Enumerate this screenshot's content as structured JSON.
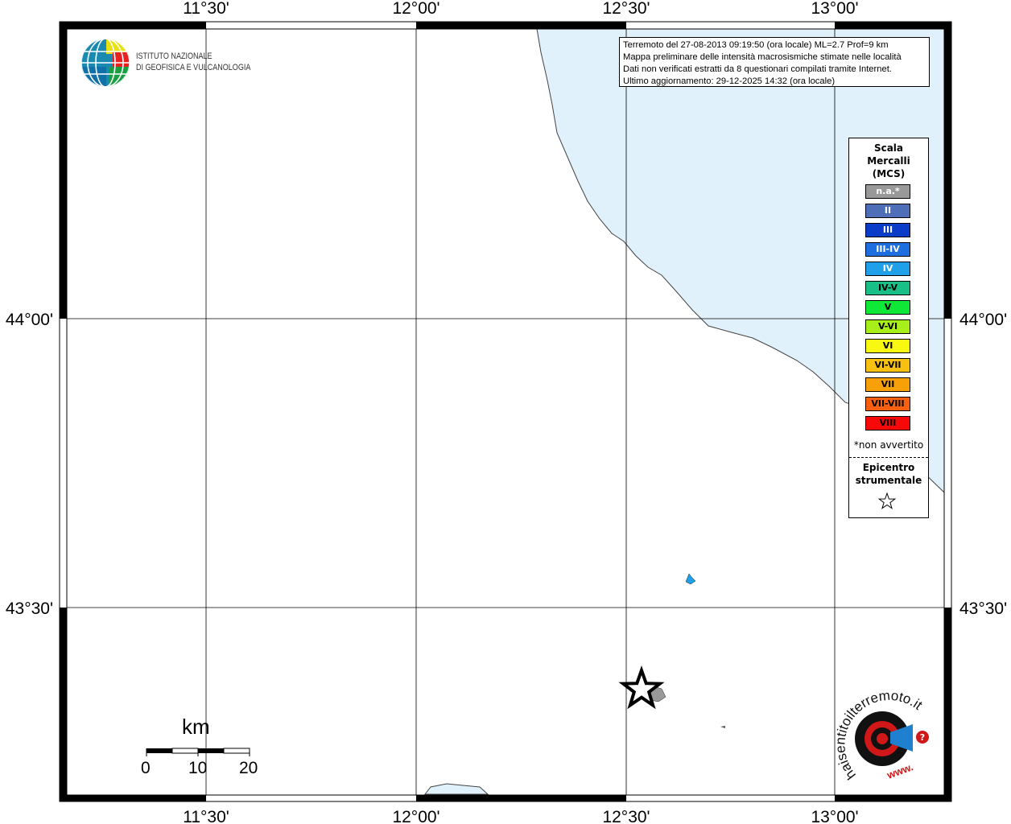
{
  "map": {
    "lon_ticks": [
      "11°30'",
      "12°00'",
      "12°30'",
      "13°00'"
    ],
    "lat_ticks": [
      "44°00'",
      "43°30'"
    ],
    "sea_color": "#e0f1fc",
    "coast_color": "#444444"
  },
  "info": {
    "line1": "Terremoto del 27-08-2013 09:19:50 (ora locale) ML=2.7 Prof=9 km",
    "line2": "Mappa preliminare delle intensità macrosismiche stimate nelle località",
    "line3": "Dati non verificati estratti da 8 questionari compilati tramite Internet.",
    "line4": "Ultimo aggiornamento: 29-12-2025 14:32 (ora locale)"
  },
  "logo": {
    "line1": "ISTITUTO NAZIONALE",
    "line2": "DI GEOFISICA E VULCANOLOGIA"
  },
  "legend": {
    "title1": "Scala",
    "title2": "Mercalli",
    "title3": "(MCS)",
    "items": [
      {
        "label": "n.a.*",
        "color": "#999999",
        "text": "#ffffff"
      },
      {
        "label": "II",
        "color": "#4e6eb8",
        "text": "#ffffff"
      },
      {
        "label": "III",
        "color": "#0a3cc8",
        "text": "#ffffff"
      },
      {
        "label": "III-IV",
        "color": "#1e6ee0",
        "text": "#ffffff"
      },
      {
        "label": "IV",
        "color": "#20a0e8",
        "text": "#ffffff"
      },
      {
        "label": "IV-V",
        "color": "#18c088",
        "text": "#000000"
      },
      {
        "label": "V",
        "color": "#10e838",
        "text": "#000000"
      },
      {
        "label": "V-VI",
        "color": "#a8ee18",
        "text": "#000000"
      },
      {
        "label": "VI",
        "color": "#f8f810",
        "text": "#000000"
      },
      {
        "label": "VI-VII",
        "color": "#f8c010",
        "text": "#000000"
      },
      {
        "label": "VII",
        "color": "#f8a008",
        "text": "#000000"
      },
      {
        "label": "VII-VIII",
        "color": "#f86010",
        "text": "#000000"
      },
      {
        "label": "VIII",
        "color": "#f80808",
        "text": "#000000"
      }
    ],
    "note": "*non avvertito",
    "epi1": "Epicentro",
    "epi2": "strumentale"
  },
  "scale": {
    "unit": "km",
    "ticks": [
      "0",
      "10",
      "20"
    ]
  },
  "badge": {
    "arc_text": "haisentitoilterremoto.it",
    "www": "www."
  },
  "observations": [
    {
      "place": "point",
      "intensity": "IV"
    },
    {
      "place": "epicentre area",
      "intensity": "n.a.*"
    }
  ]
}
